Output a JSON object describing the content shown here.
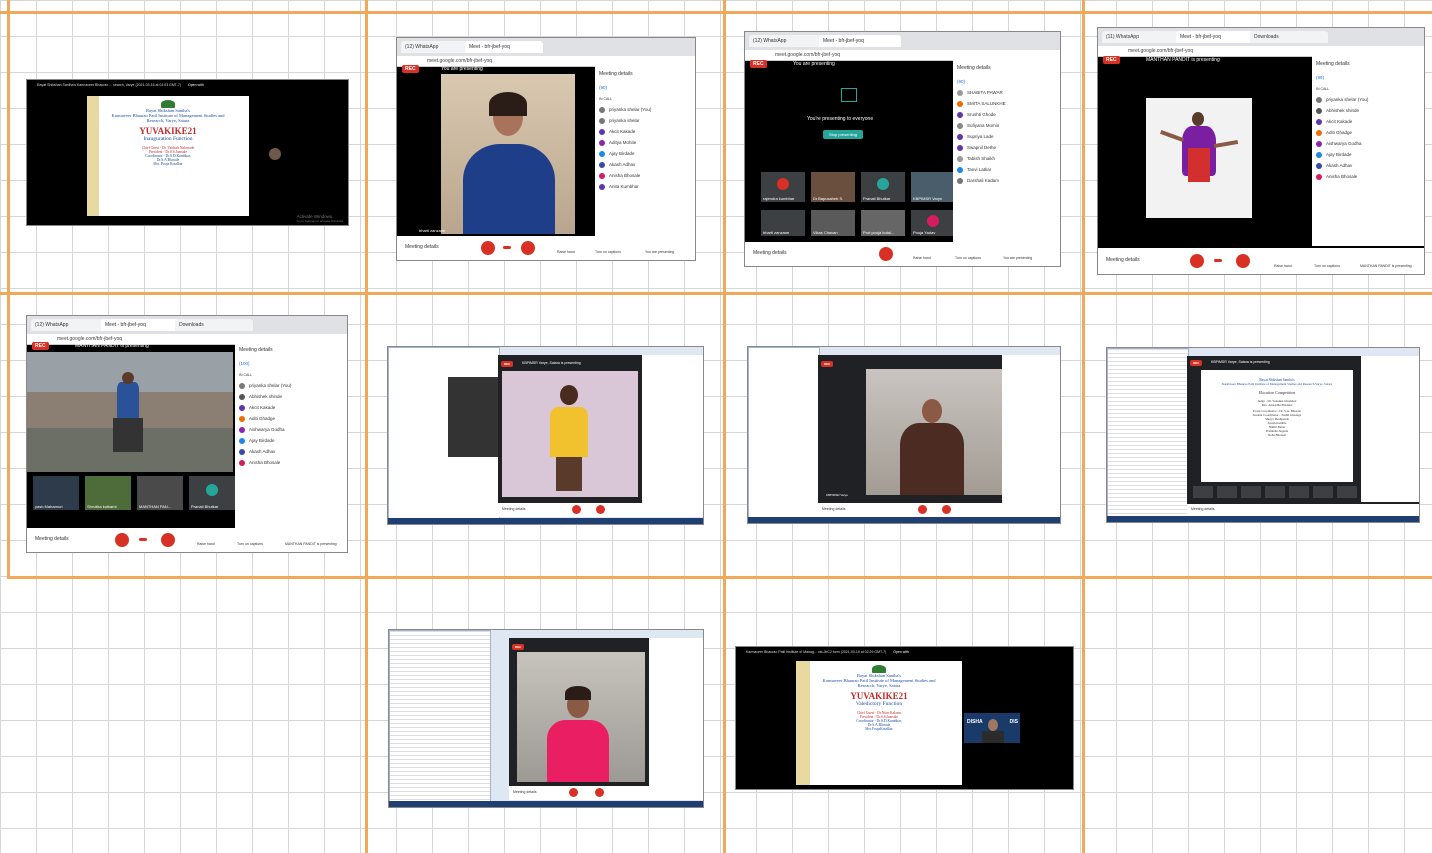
{
  "collage": {
    "shot1": {
      "titlebar": "Rayat Shikshan Santha's Karmaveer Bhaurao ... search, Varye (2021-03-16 at 02:03 GMT-7)",
      "open_with": "Open with",
      "slide": {
        "line1": "Rayat Shikshan Santha's",
        "line2": "Karmaveer Bhaurao Patil Institute of Management Studies and",
        "line3": "Research, Varye, Satara",
        "event": "YUVAKIKE21",
        "subtitle": "Inauguration Function",
        "chief": "Chief Guest - Dr. Vaishali Nalawade",
        "president": "President - Dr.S.S.Jamsale",
        "coordinator": "Coordinator - Dr.S.D.Kumbhar,",
        "c2": "Dr.S.A.Bhosale",
        "c3": "Mrs. Pooja Kotalkar"
      },
      "watermark": "Activate Windows",
      "watermark_sub": "Go to Settings to activate Windows."
    },
    "shot2": {
      "tab1": "(12) WhatsApp",
      "tab2": "Meet - bfr-jbef-yoq",
      "url": "meet.google.com/bfr-jbef-yoq",
      "rec": "REC",
      "presenting": "You are presenting",
      "panel_title": "Meeting details",
      "in_call": "IN CALL",
      "count": "(90)",
      "participants": [
        "priyanka shelar (You)",
        "priyanka shelar",
        "Akcit Kakade",
        "Aditya Mohite",
        "Ajay Birdade",
        "Akash Adhav",
        "Anisha Bhosale",
        "Anita Kumbhar"
      ],
      "speaker": "bharti zanzane",
      "meeting_details": "Meeting details",
      "raise_hand": "Raise hand",
      "captions": "Turn on captions",
      "you_present": "You are presenting"
    },
    "shot3": {
      "tab1": "(12) WhatsApp",
      "tab2": "Meet - bfr-jbef-yoq",
      "url": "meet.google.com/bfr-jbef-yoq",
      "rec": "REC",
      "presenting": "You are presenting",
      "center_text": "You're presenting to everyone",
      "stop": "Stop presenting",
      "panel_title": "Meeting details",
      "count": "(90)",
      "participants": [
        "SHABITA PAWAR",
        "SMITA SALUNKHE",
        "Srushti Ghode",
        "Sufiyana Momin",
        "Supriya Lade",
        "Swapnil Dethe",
        "Tabish Shaikh",
        "Tanvi Latkar",
        "Darshali Kadam"
      ],
      "tiles": [
        "rajendra kumbhar",
        "Dr.Bapusaheb S.",
        "Pranali Bhutkar",
        "KBPIMSR Varye",
        "bharti zanzane",
        "Vikas Chavan",
        "Prof.pooja kotal...",
        "Pooja Yadav"
      ],
      "meeting_details": "Meeting details",
      "raise_hand": "Raise hand",
      "captions": "Turn on captions",
      "you_present": "You are presenting"
    },
    "shot4": {
      "tab1": "(11) WhatsApp",
      "tab2": "Meet - bfr-jbef-yoq",
      "tab3": "Downloads",
      "url": "meet.google.com/bfr-jbef-yoq",
      "rec": "REC",
      "presenting": "MANTHAN PANDIT is presenting",
      "panel_title": "Meeting details",
      "in_call": "IN CALL",
      "count": "(99)",
      "participants": [
        "priyanka shelar (You)",
        "Abhishek shinde",
        "Akcit Kakade",
        "Aditi Ghadge",
        "Aishwarya Godha",
        "Ajay Birdade",
        "Akash Adhav",
        "Anisha Bhosale"
      ],
      "meeting_details": "Meeting details",
      "raise_hand": "Raise hand",
      "captions": "Turn on captions",
      "presenter": "MANTHAN PANDIT is presenting"
    },
    "shot5": {
      "tab1": "(12) WhatsApp",
      "tab2": "Meet - bfr-jbef-yoq",
      "tab3": "Downloads",
      "url": "meet.google.com/bfr-jbef-yoq",
      "rec": "REC",
      "presenting": "MANTHAN PANDIT is presenting",
      "panel_title": "Meeting details",
      "in_call": "IN CALL",
      "count": "(100)",
      "participants": [
        "priyanka shelar (You)",
        "Abhishek shinde",
        "Akcit Kakade",
        "Aditi Ghadge",
        "Aishwarya Godha",
        "Ajay Birdade",
        "Akash Adhav",
        "Anisha Bhosale"
      ],
      "tiles": [
        "yash Maharnuri",
        "Shrutika kulkarni",
        "MANTHAN PAN...",
        "Pranali Bhutkar"
      ],
      "meeting_details": "Meeting details",
      "raise_hand": "Raise hand",
      "captions": "Turn on captions",
      "presenter": "MANTHAN PANDIT is presenting"
    },
    "shot6": {
      "presenting": "KBPIMSR Varye, Satara is presenting",
      "meeting_details": "Meeting details"
    },
    "shot7": {
      "presenting": "KBPIMSR Varye",
      "meeting_details": "Meeting details"
    },
    "shot8": {
      "presenting": "KBPIMSR Varye, Satara is presenting",
      "meeting_details": "Meeting details",
      "slide": {
        "l1": "Rayat Shikshan Santha's",
        "l2": "Karmaveer Bhaurao Patil Institute of Management Studies and Research Varye, Satara",
        "l3": "Elocution Competition",
        "judge": "Judge - Dr. Sunanna Ghadekar",
        "judge2": "Mrs. Anuradha Phadake",
        "event": "Event Coordinator - Dr. S.A. Bhosale",
        "student": "Student Coordinator - Tushil Ghadage",
        "s2": "Shreya Deshpande",
        "s3": "Ayush Kamble",
        "s4": "Nikhil Babar",
        "s5": "Pratiksha Jagdale",
        "s6": "Neha Bhonsal"
      }
    },
    "shot9": {
      "meeting_details": "Meeting details"
    },
    "shot10": {
      "titlebar": "Karmaveer Bhaurao Patil Institute of Manag... ust-JbC2 form (2021-03-19 at 02:29 GMT-7)",
      "open_with": "Open with",
      "slide": {
        "line1": "Rayat Shikshan Santha's",
        "line2": "Karmaveer Bhaurao Patil Institute of Management Studies and",
        "line3": "Research, Varye, Satara",
        "event": "YUVAKIKE21",
        "subtitle": "Valedictory Function",
        "chief": "Chief Guest - Dr.Nitin Kalaras",
        "president": "President - Dr.S.S.Jamsale",
        "coordinator": "Coordinator - Dr.S.D.Kumbhar,",
        "c2": "Dr.S.A.Bhosale",
        "c3": "Mrs.PoojaKotalkar"
      },
      "sign": "DISHA",
      "sign2": "DIS"
    }
  }
}
